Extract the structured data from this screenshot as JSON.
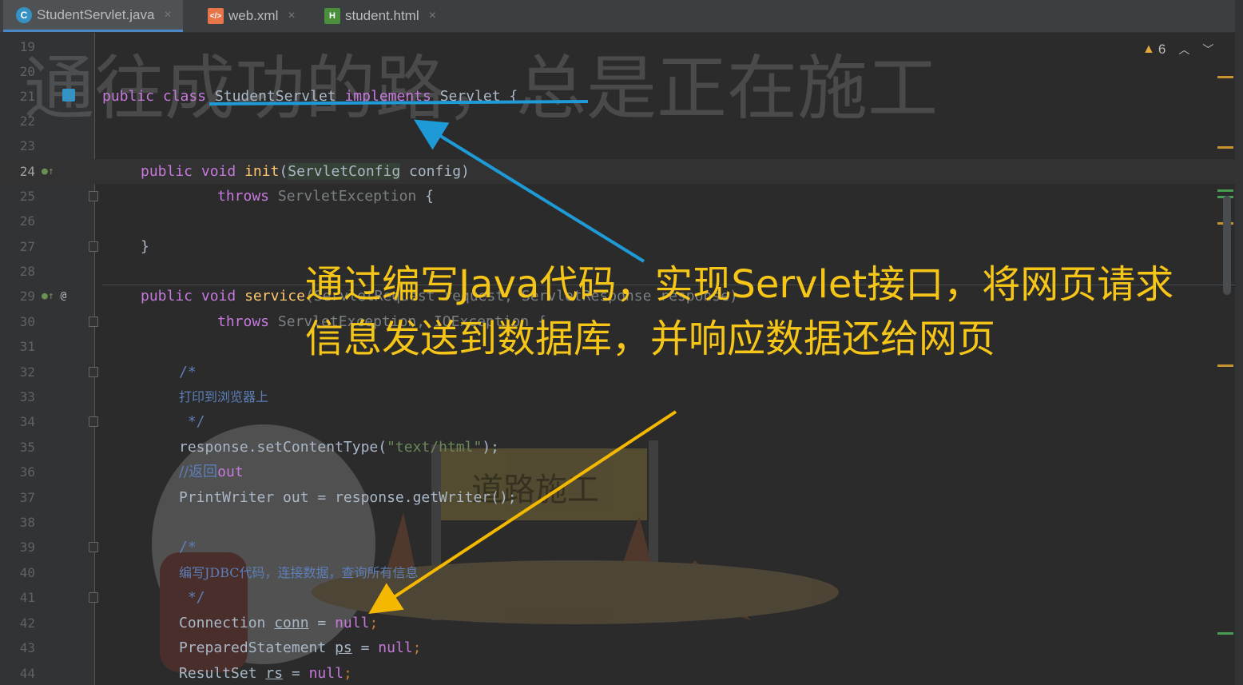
{
  "tabs": [
    {
      "label": "StudentServlet.java",
      "icon": "java-class-icon",
      "active": true
    },
    {
      "label": "web.xml",
      "icon": "xml-file-icon",
      "active": false
    },
    {
      "label": "student.html",
      "icon": "html-file-icon",
      "active": false
    }
  ],
  "close_glyph": "×",
  "inspection": {
    "warning_count": "6"
  },
  "background_art": {
    "banner": "通往成功的路，总是正在施工",
    "sign": "道路施工"
  },
  "lines": [
    {
      "n": "19"
    },
    {
      "n": "20"
    },
    {
      "n": "21"
    },
    {
      "n": "22"
    },
    {
      "n": "23"
    },
    {
      "n": "24"
    },
    {
      "n": "25"
    },
    {
      "n": "26"
    },
    {
      "n": "27"
    },
    {
      "n": "28"
    },
    {
      "n": "29"
    },
    {
      "n": "30"
    },
    {
      "n": "31"
    },
    {
      "n": "32"
    },
    {
      "n": "33"
    },
    {
      "n": "34"
    },
    {
      "n": "35"
    },
    {
      "n": "36"
    },
    {
      "n": "37"
    },
    {
      "n": "38"
    },
    {
      "n": "39"
    },
    {
      "n": "40"
    },
    {
      "n": "41"
    },
    {
      "n": "42"
    },
    {
      "n": "43"
    },
    {
      "n": "44"
    }
  ],
  "code": {
    "l21": {
      "a": "public",
      "b": "class",
      "c": "StudentServlet",
      "d": "implements",
      "e": "Servlet {"
    },
    "l24": {
      "a": "public",
      "b": "void",
      "c": "init",
      "d": "(",
      "e": "ServletConfig",
      "f": " config)"
    },
    "l25": {
      "a": "throws",
      "b": "ServletException",
      "c": " {"
    },
    "l27": {
      "a": "}"
    },
    "l29": {
      "a": "public",
      "b": "void",
      "c": "service",
      "d": "(ServletRequest request, ServletResponse response)"
    },
    "l30": {
      "a": "throws",
      "b": "ServletException, IOException {"
    },
    "l32": {
      "a": "/*"
    },
    "l33": {
      "a": "打印到浏览器上"
    },
    "l34": {
      "a": " */"
    },
    "l35": {
      "a": "response.setContentType(",
      "b": "\"text/html\"",
      "c": ");"
    },
    "l36": {
      "a": "//返回",
      "b": "out"
    },
    "l37": {
      "a": "PrintWriter out = response.getWriter();"
    },
    "l39": {
      "a": "/*"
    },
    "l40": {
      "a": "编写JDBC代码，连接数据，查询所有信息"
    },
    "l41": {
      "a": " */"
    },
    "l42": {
      "a": "Connection ",
      "b": "conn",
      "c": " = ",
      "d": "null",
      ";": ";"
    },
    "l43": {
      "a": "PreparedStatement ",
      "b": "ps",
      "c": " = ",
      "d": "null",
      "e": ";"
    },
    "l44": {
      "a": "ResultSet ",
      "b": "rs",
      "c": " = ",
      "d": "null",
      "e": ";"
    }
  },
  "annotation": {
    "line1": "通过编写Java代码，实现Servlet接口，将网页请求",
    "line2": "信息发送到数据库，并响应数据还给网页"
  },
  "colors": {
    "annotation": "#f5c518",
    "arrow_blue": "#1e9ad6",
    "arrow_yellow": "#f5b800"
  }
}
